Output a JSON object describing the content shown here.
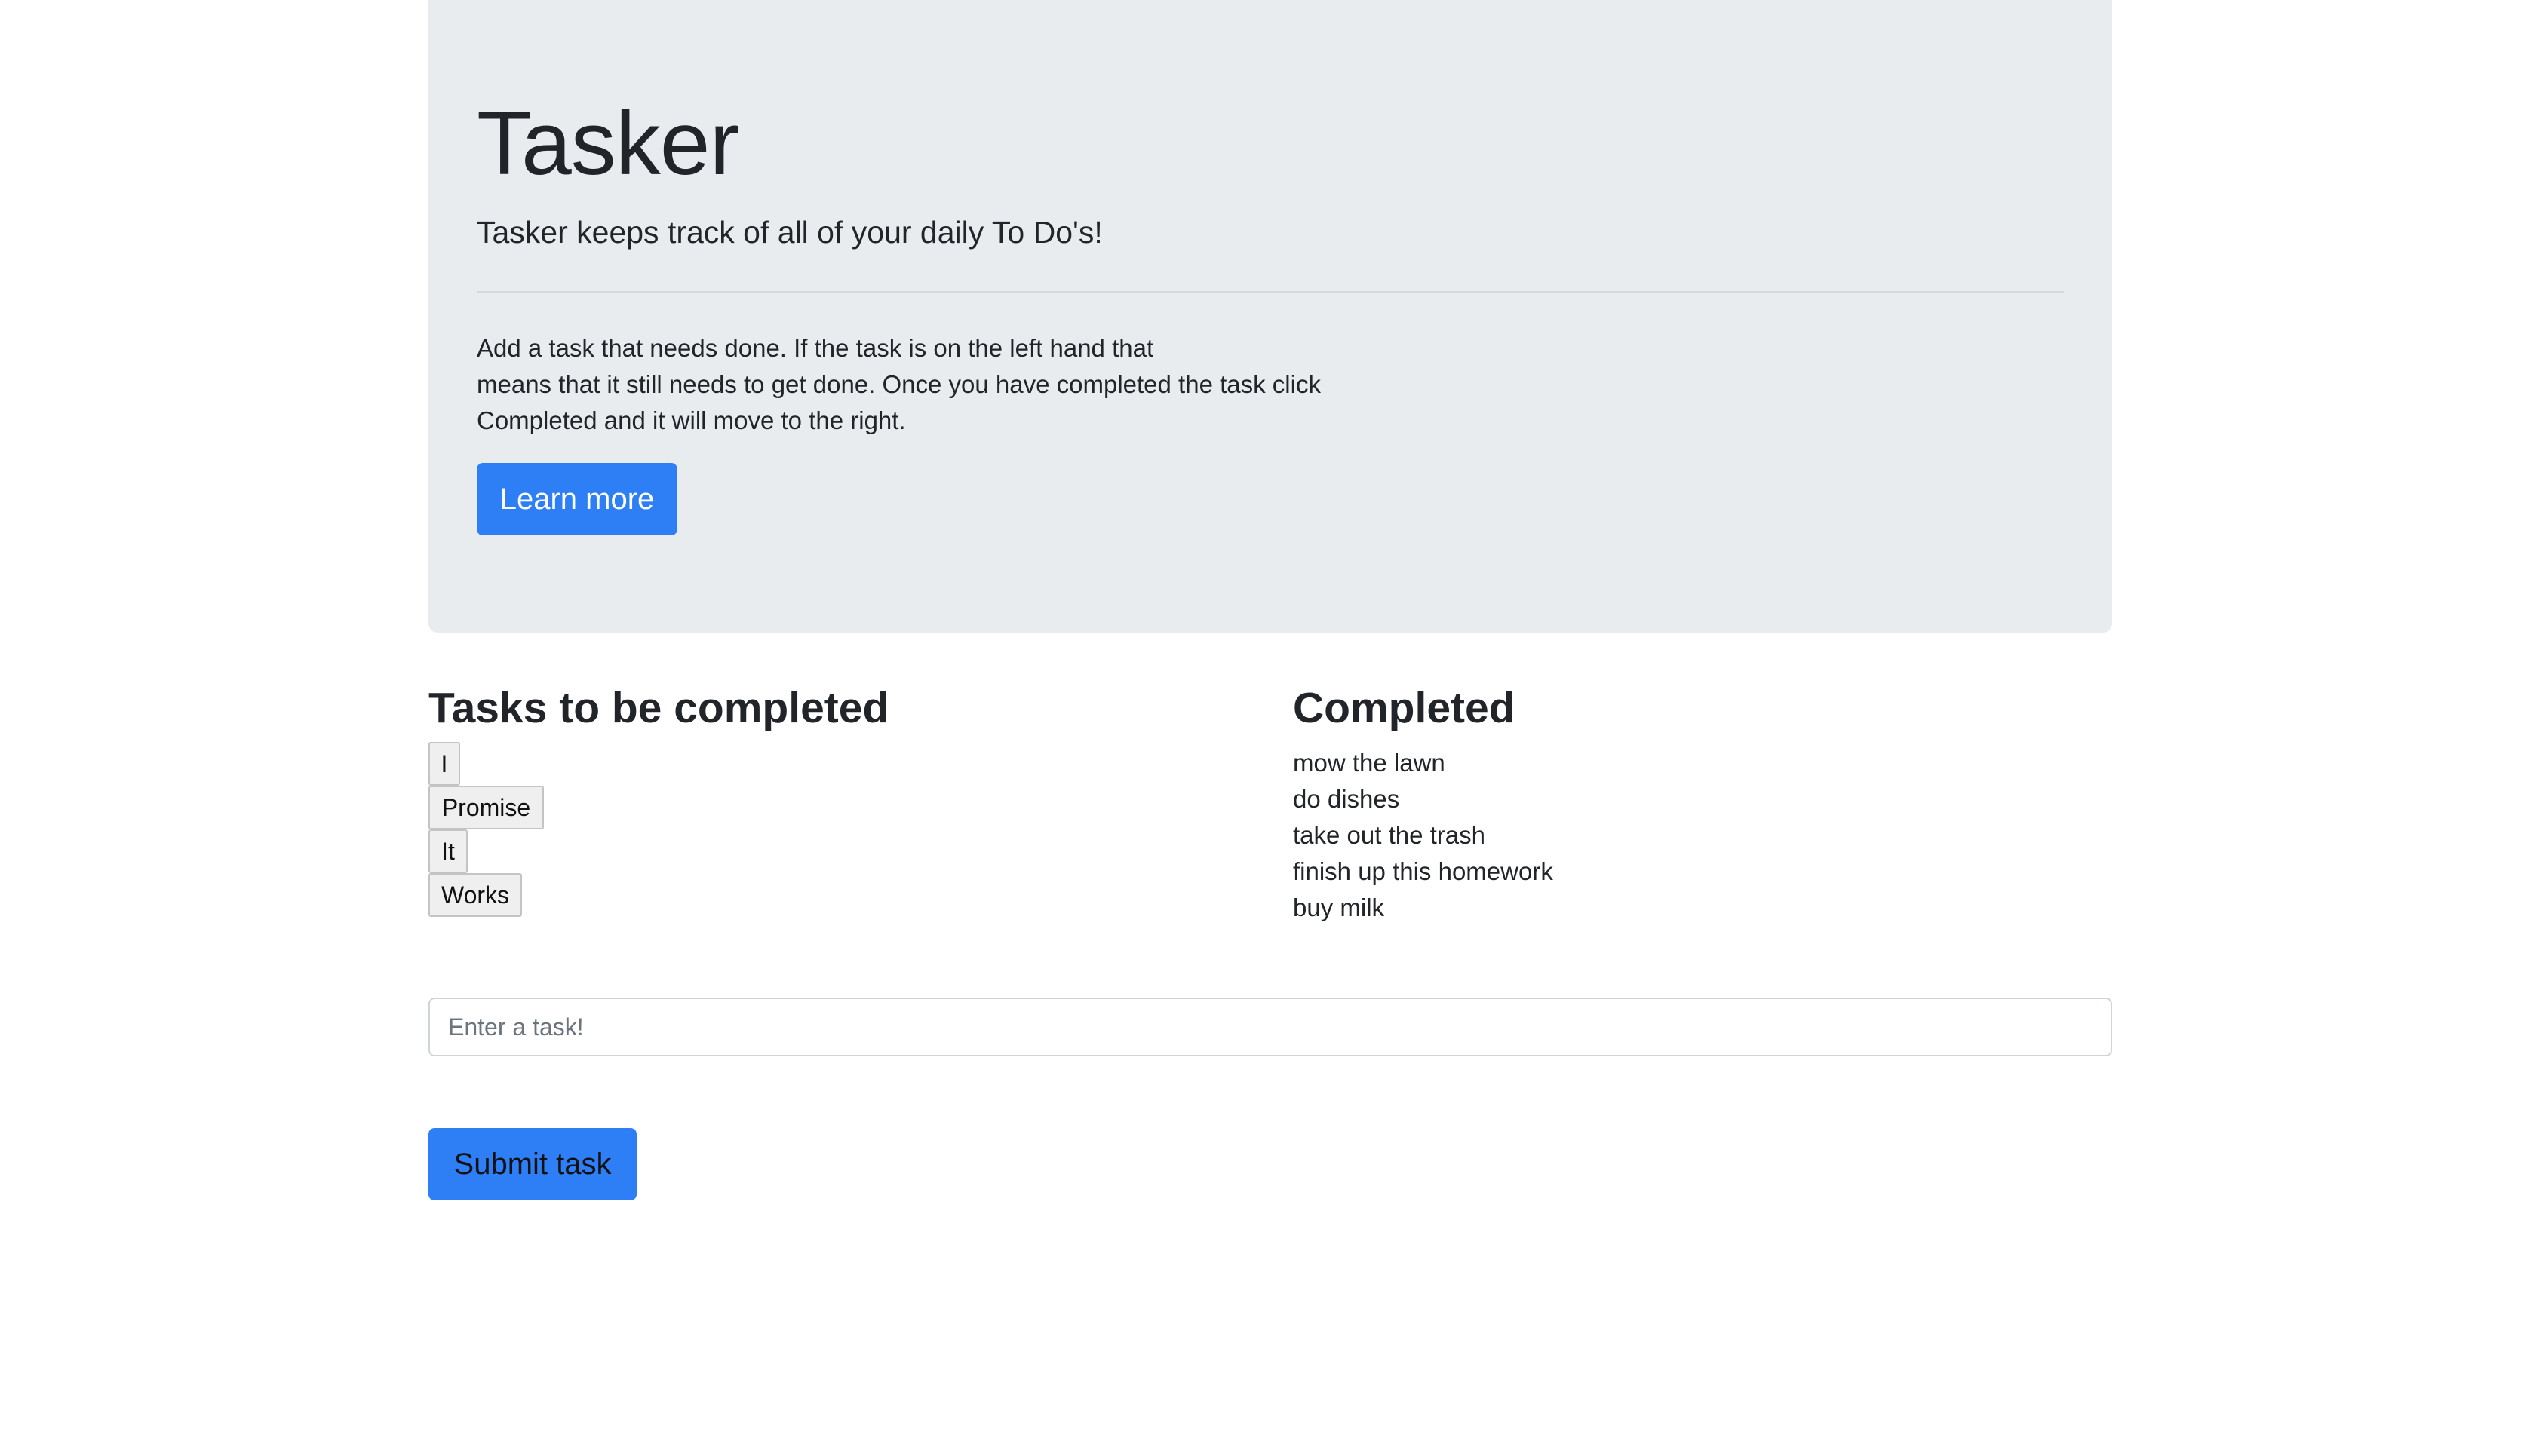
{
  "hero": {
    "title": "Tasker",
    "lead": "Tasker keeps track of all of your daily To Do's!",
    "body_lines": [
      "Add a task that needs done. If the task is on the left hand that",
      "means that it still needs to get done. Once you have completed the task click",
      "Completed and it will move to the right."
    ],
    "learn_more_label": "Learn more"
  },
  "pending": {
    "heading": "Tasks to be completed",
    "tasks": [
      "I",
      "Promise",
      "It",
      "Works"
    ]
  },
  "completed": {
    "heading": "Completed",
    "items": [
      "mow the lawn",
      "do dishes",
      "take out the trash",
      "finish up this homework",
      "buy milk"
    ]
  },
  "form": {
    "input_placeholder": "Enter a task!",
    "input_value": "",
    "submit_label": "Submit task"
  },
  "colors": {
    "primary": "#2e7ff6",
    "jumbotron_bg": "#e9ecef",
    "text": "#212529"
  }
}
